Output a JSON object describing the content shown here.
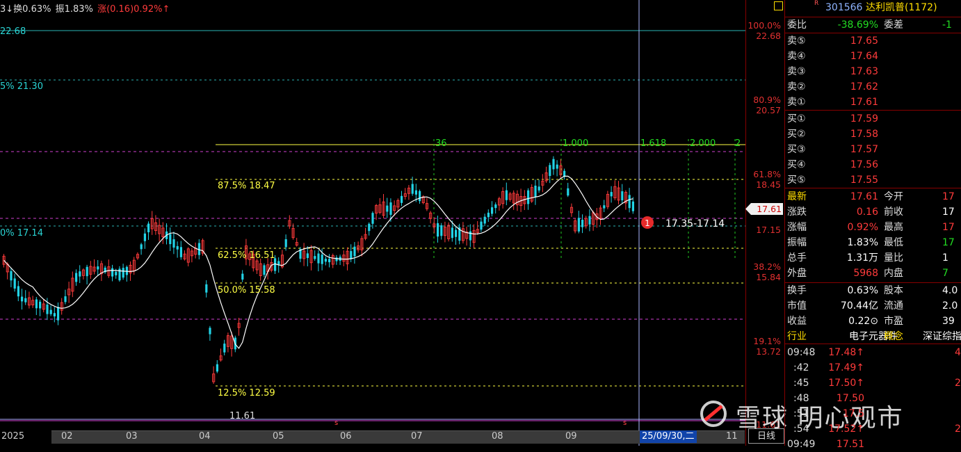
{
  "colors": {
    "up": "#ff3b3b",
    "down": "#22d3e6",
    "ma": "#ffffff",
    "fib": "#ffff44",
    "pink": "#d040d0",
    "cyan_line": "#2ab5b5",
    "green_grid": "#22cc22"
  },
  "topbar": {
    "item1": "3↓换0.63%",
    "item2": "振1.83%",
    "item3": "涨(0.16)0.92%↑"
  },
  "price_axis": [
    {
      "pct": "100.0%",
      "price": "22.68"
    },
    {
      "pct": "80.9%",
      "price": "20.57"
    },
    {
      "pct": "61.8%",
      "price": "18.45"
    },
    {
      "pct": "",
      "price": "17.15"
    },
    {
      "pct": "38.2%",
      "price": "15.84"
    },
    {
      "pct": "19.1%",
      "price": "13.72"
    },
    {
      "pct": "",
      "price": "11.61"
    }
  ],
  "current_price_tag": "17.61",
  "fib_labels": {
    "top_left": "22.68",
    "lv_a": "5% 21.30",
    "lv_b": "0% 17.14",
    "lv_875": "87.5% 18.47",
    "lv_625": "62.5% 16.51",
    "lv_500": "50.0% 15.58",
    "lv_125": "12.5% 12.59",
    "low": "11.61"
  },
  "fib_time": [
    "36",
    "1.000",
    "1.618",
    "2.000",
    "2"
  ],
  "annotation": {
    "badge": "1",
    "range": "17.35-17.14"
  },
  "months": [
    "2025",
    "02",
    "03",
    "04",
    "05",
    "06",
    "07",
    "08",
    "09",
    "11"
  ],
  "date_highlight": "25/09/30,二",
  "day_button": "日线",
  "watermark": "雪球 明心观市",
  "panel": {
    "r_mark": "R",
    "code": "301566",
    "name": "达利凯普",
    "count": "(1172)",
    "webi_label": "委比",
    "webi": "-38.69%",
    "weicha_label": "委差",
    "weicha": "-1",
    "sell": [
      {
        "label": "卖⑤",
        "price": "17.65"
      },
      {
        "label": "卖④",
        "price": "17.64"
      },
      {
        "label": "卖③",
        "price": "17.63"
      },
      {
        "label": "卖②",
        "price": "17.62"
      },
      {
        "label": "卖①",
        "price": "17.61"
      }
    ],
    "buy": [
      {
        "label": "买①",
        "price": "17.59"
      },
      {
        "label": "买②",
        "price": "17.58"
      },
      {
        "label": "买③",
        "price": "17.57"
      },
      {
        "label": "买④",
        "price": "17.56"
      },
      {
        "label": "买⑤",
        "price": "17.55"
      }
    ],
    "stats": [
      {
        "l": "最新",
        "v": "17.61",
        "l2": "今开",
        "v2": "17"
      },
      {
        "l": "涨跌",
        "v": "0.16",
        "l2": "前收",
        "v2": "17"
      },
      {
        "l": "涨幅",
        "v": "0.92%",
        "l2": "最高",
        "v2": "17"
      },
      {
        "l": "振幅",
        "v": "1.83%",
        "l2": "最低",
        "v2": "17"
      },
      {
        "l": "总手",
        "v": "1.31万",
        "l2": "量比",
        "v2": "1"
      },
      {
        "l": "外盘",
        "v": "5968",
        "l2": "内盘",
        "v2": "7"
      }
    ],
    "stats2": [
      {
        "l": "换手",
        "v": "0.63%",
        "l2": "股本",
        "v2": "4.0"
      },
      {
        "l": "市值",
        "v": "70.44亿",
        "l2": "流通",
        "v2": "2.0"
      },
      {
        "l": "收益",
        "v": "0.22⊙",
        "l2": "市盈",
        "v2": "39"
      },
      {
        "l": "行业",
        "v": "电子元器件",
        "l2": "概念",
        "v2": "深证综指"
      }
    ],
    "ticks": [
      {
        "t": "09:48",
        "p": "17.48↑",
        "v": "4"
      },
      {
        "t": ":42",
        "p": "17.49↑",
        "v": ""
      },
      {
        "t": ":45",
        "p": "17.50↑",
        "v": "2"
      },
      {
        "t": ":48",
        "p": "17.50",
        "v": ""
      },
      {
        "t": ":51",
        "p": "17.5",
        "v": ""
      },
      {
        "t": ":54",
        "p": "17.52↑",
        "v": "2"
      },
      {
        "t": "09:49",
        "p": "17.51",
        "v": ""
      }
    ]
  }
}
